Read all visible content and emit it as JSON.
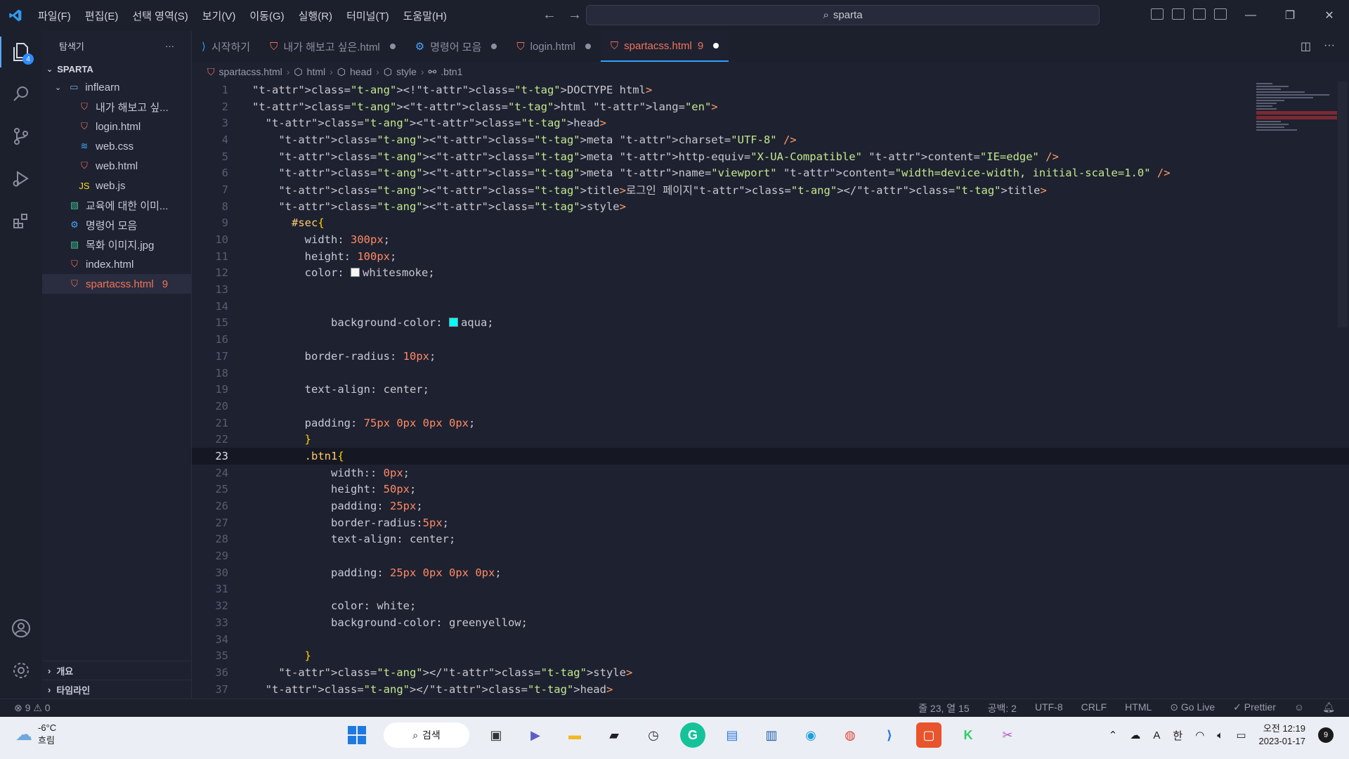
{
  "menu": [
    "파일(F)",
    "편집(E)",
    "선택 영역(S)",
    "보기(V)",
    "이동(G)",
    "실행(R)",
    "터미널(T)",
    "도움말(H)"
  ],
  "search": {
    "value": "sparta"
  },
  "sidebar": {
    "title": "탐색기",
    "root": "SPARTA",
    "items": [
      {
        "label": "inflearn",
        "icon": "folder-icon",
        "indent": 1
      },
      {
        "label": "내가 해보고 싶...",
        "icon": "html-icon",
        "indent": 2
      },
      {
        "label": "login.html",
        "icon": "html-icon",
        "indent": 2
      },
      {
        "label": "web.css",
        "icon": "css-icon",
        "indent": 2
      },
      {
        "label": "web.html",
        "icon": "html-icon",
        "indent": 2
      },
      {
        "label": "web.js",
        "icon": "js-icon",
        "indent": 2
      },
      {
        "label": "교육에 대한 이미...",
        "icon": "image-icon",
        "indent": 1
      },
      {
        "label": "명령어 모음",
        "icon": "gear-icon",
        "indent": 1
      },
      {
        "label": "목화 이미지.jpg",
        "icon": "image-icon",
        "indent": 1
      },
      {
        "label": "index.html",
        "icon": "html-icon",
        "indent": 1
      },
      {
        "label": "spartacss.html",
        "icon": "html-icon",
        "indent": 1,
        "badge": "9"
      }
    ],
    "outline": "개요",
    "timeline": "타임라인",
    "explorer_badge": "4"
  },
  "tabs": [
    {
      "label": "시작하기",
      "icon": "vscode-icon"
    },
    {
      "label": "내가 해보고 싶은.html",
      "icon": "html-icon",
      "dirty": true
    },
    {
      "label": "명령어 모음",
      "icon": "gear-icon",
      "dirty": true
    },
    {
      "label": "login.html",
      "icon": "html-icon",
      "dirty": true
    },
    {
      "label": "spartacss.html",
      "icon": "html-icon",
      "dirty": true,
      "active": true,
      "badge": "9"
    }
  ],
  "breadcrumb": [
    "spartacss.html",
    "html",
    "head",
    "style",
    ".btn1"
  ],
  "editor": {
    "current_line": 23,
    "lines": [
      "<!DOCTYPE html>",
      "<html lang=\"en\">",
      "  <head>",
      "    <meta charset=\"UTF-8\" />",
      "    <meta http-equiv=\"X-UA-Compatible\" content=\"IE=edge\" />",
      "    <meta name=\"viewport\" content=\"width=device-width, initial-scale=1.0\" />",
      "    <title>로그인 페이지</title>",
      "    <style>",
      "      #sec {",
      "        width: 300px;",
      "        height: 100px;",
      "        color: whitesmoke;",
      "",
      "",
      "            background-color: aqua;",
      "",
      "        border-radius: 10px;",
      "",
      "        text-align: center;",
      "",
      "        padding: 75px 0px 0px 0px;",
      "        }",
      "        .btn1{",
      "            width:: 0px;",
      "            height: 50px;",
      "            padding: 25px;",
      "            border-radius:5px;",
      "            text-align: center;",
      "",
      "            padding: 25px 0px 0px 0px;",
      "",
      "            color: white;",
      "            background-color: greenyellow;",
      "",
      "        }",
      "    </style>",
      "  </head>"
    ]
  },
  "status": {
    "errors": "9",
    "warnings": "0",
    "position": "줄 23, 열 15",
    "spaces": "공백: 2",
    "encoding": "UTF-8",
    "eol": "CRLF",
    "language": "HTML",
    "golive": "Go Live",
    "prettier": "Prettier"
  },
  "taskbar": {
    "temperature": "-6°C",
    "weather": "흐림",
    "search": "검색",
    "ime": "한",
    "time": "오전 12:19",
    "date": "2023-01-17",
    "notifications": "9"
  },
  "colors": {
    "accent": "#2fa0ff",
    "html_icon": "#f0745a",
    "css_icon": "#42a5f5",
    "js_icon": "#f7df1e",
    "swatch_whitesmoke": "#f5f5f5",
    "swatch_aqua": "#00ffff"
  }
}
